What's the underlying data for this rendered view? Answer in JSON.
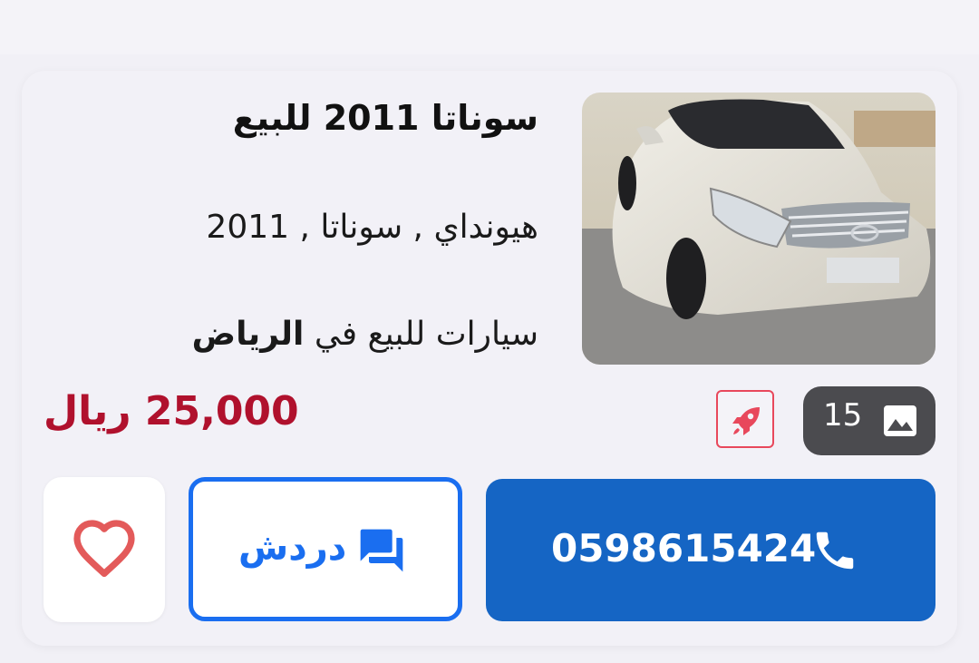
{
  "listing": {
    "title": "سوناتا 2011 للبيع",
    "subtitle": "هيونداي , سوناتا , 2011",
    "location_prefix": "سيارات للبيع في",
    "location_city": "الرياض",
    "price": "25,000 ريال",
    "photo_count": "15"
  },
  "actions": {
    "call_number": "0598615424",
    "chat_label": "دردش"
  },
  "icons": {
    "photos": "image-icon",
    "boost": "rocket-icon",
    "call": "phone-icon",
    "chat": "chat-icon",
    "favorite": "heart-icon"
  },
  "colors": {
    "price": "#b0112d",
    "call_button": "#1565c4",
    "chat_accent": "#1a6ef0",
    "boost_accent": "#e8485c",
    "favorite": "#e35a5a"
  }
}
